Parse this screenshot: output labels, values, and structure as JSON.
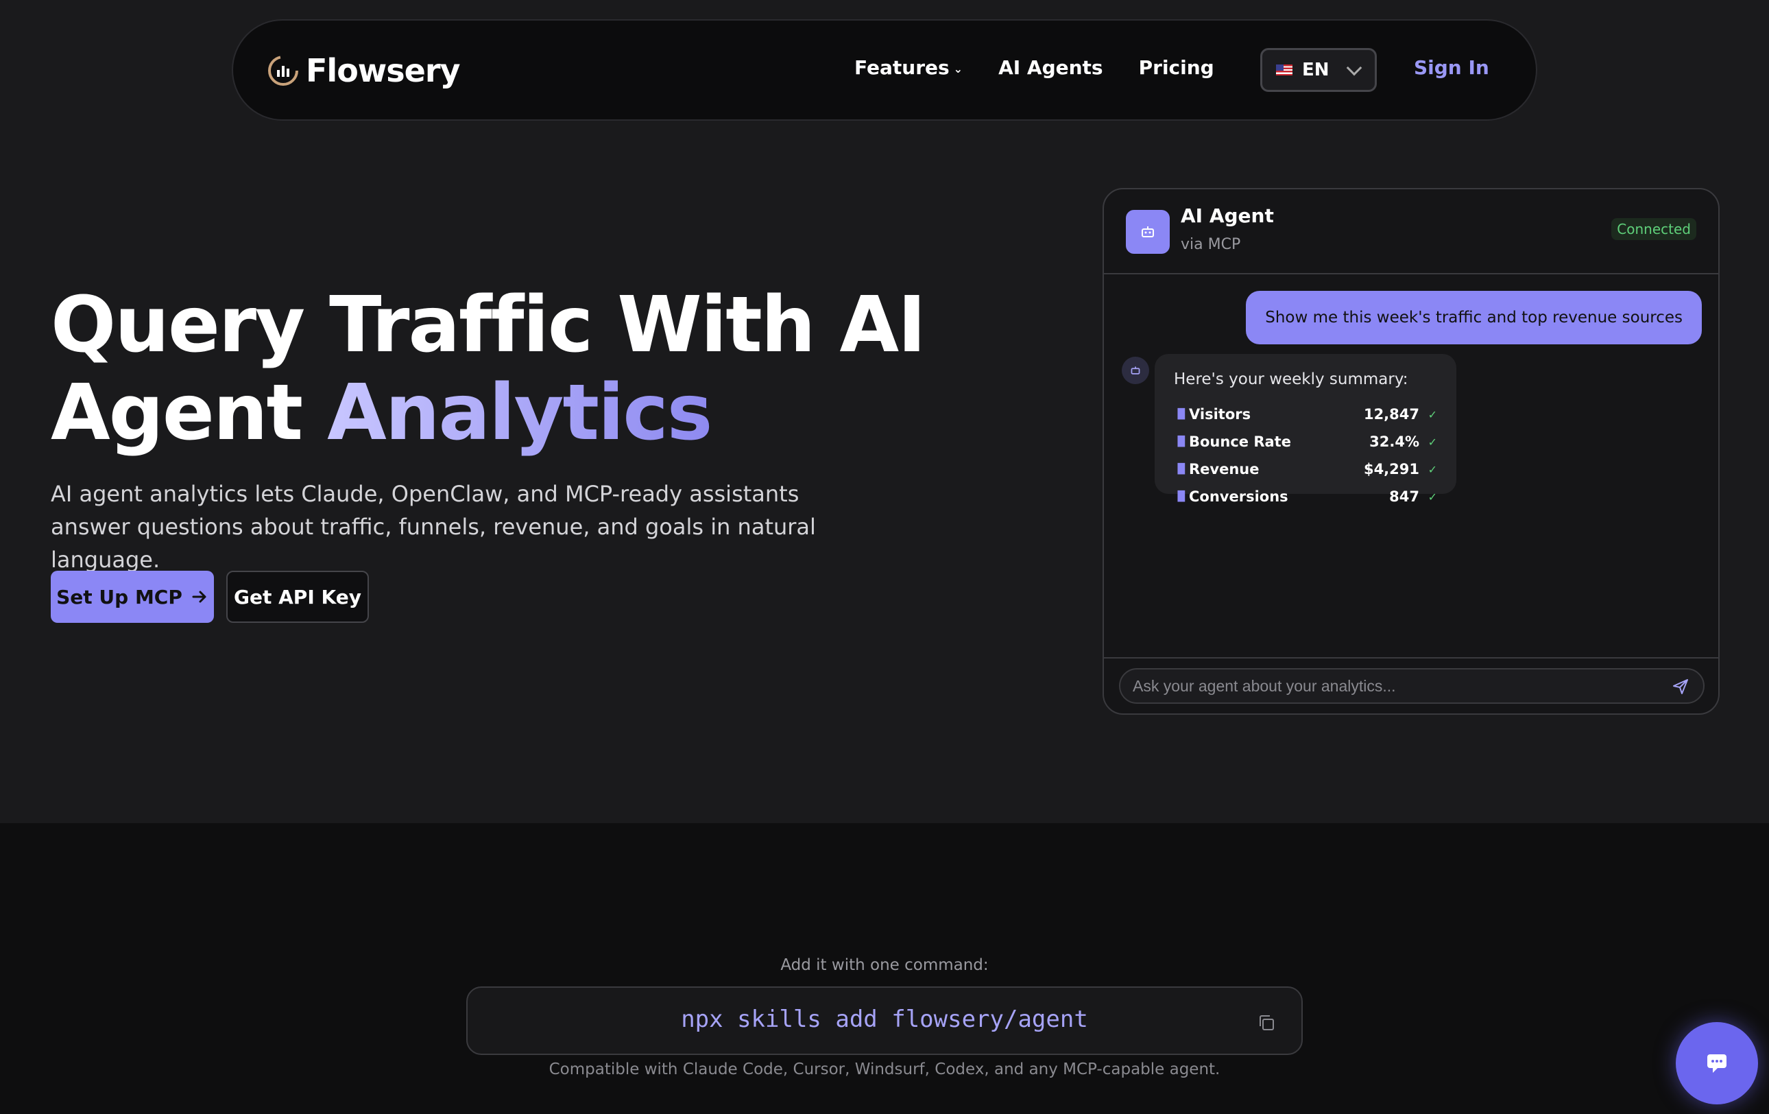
{
  "nav": {
    "logo_text": "Flowsery",
    "links": [
      {
        "label": "Features",
        "has_dropdown": true
      },
      {
        "label": "AI Agents",
        "has_dropdown": false
      },
      {
        "label": "Pricing",
        "has_dropdown": false
      }
    ],
    "language": {
      "flag": "us-flag-icon",
      "label": "EN"
    },
    "sign_in": "Sign In"
  },
  "hero": {
    "title_line1": "Query Traffic With AI",
    "title_line2_plain": "Agent ",
    "title_line2_accent": "Analytics",
    "subtitle": "AI agent analytics lets Claude, OpenClaw, and MCP-ready assistants answer questions about traffic, funnels, revenue, and goals in natural language.",
    "primary_button": "Set Up MCP",
    "secondary_button": "Get API Key"
  },
  "agent_card": {
    "name": "AI Agent",
    "via": "via MCP",
    "status": "Connected",
    "user_message": "Show me this week's traffic and top revenue sources",
    "bot_intro": "Here's your weekly summary:",
    "metrics": [
      {
        "label": "Visitors",
        "value": "12,847"
      },
      {
        "label": "Bounce Rate",
        "value": "32.4%"
      },
      {
        "label": "Revenue",
        "value": "$4,291"
      },
      {
        "label": "Conversions",
        "value": "847"
      }
    ],
    "input_placeholder": "Ask your agent about your analytics..."
  },
  "command": {
    "label": "Add it with one command:",
    "text": "npx skills add flowsery/agent",
    "compat": "Compatible with Claude Code, Cursor, Windsurf, Codex, and any MCP-capable agent."
  },
  "colors": {
    "accent": "#8b87f5",
    "background": "#1a1a1c",
    "success": "#5fd07a"
  }
}
